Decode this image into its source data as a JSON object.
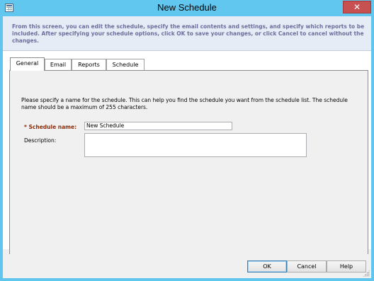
{
  "window": {
    "title": "New Schedule",
    "close_symbol": "✕"
  },
  "intro": {
    "text": "From this screen, you can edit the schedule, specify the email contents and settings, and specify which reports to be included. After specifying your schedule options, click OK to save your changes, or click Cancel to cancel without the changes."
  },
  "tabs": [
    {
      "label": "General",
      "active": true
    },
    {
      "label": "Email",
      "active": false
    },
    {
      "label": "Reports",
      "active": false
    },
    {
      "label": "Schedule",
      "active": false
    }
  ],
  "general": {
    "description": "Please specify a name for the schedule. This can help you find the schedule you want from the schedule list. The schedule name should be a maximum of 255 characters.",
    "name_label": "* Schedule name:",
    "name_value": "New Schedule",
    "description_label": "Description:",
    "description_value": ""
  },
  "buttons": {
    "ok": "OK",
    "cancel": "Cancel",
    "help": "Help"
  },
  "colors": {
    "title_bar": "#62c7ee",
    "required_label": "#8b2f0e",
    "intro_text": "#6b6f9c"
  }
}
